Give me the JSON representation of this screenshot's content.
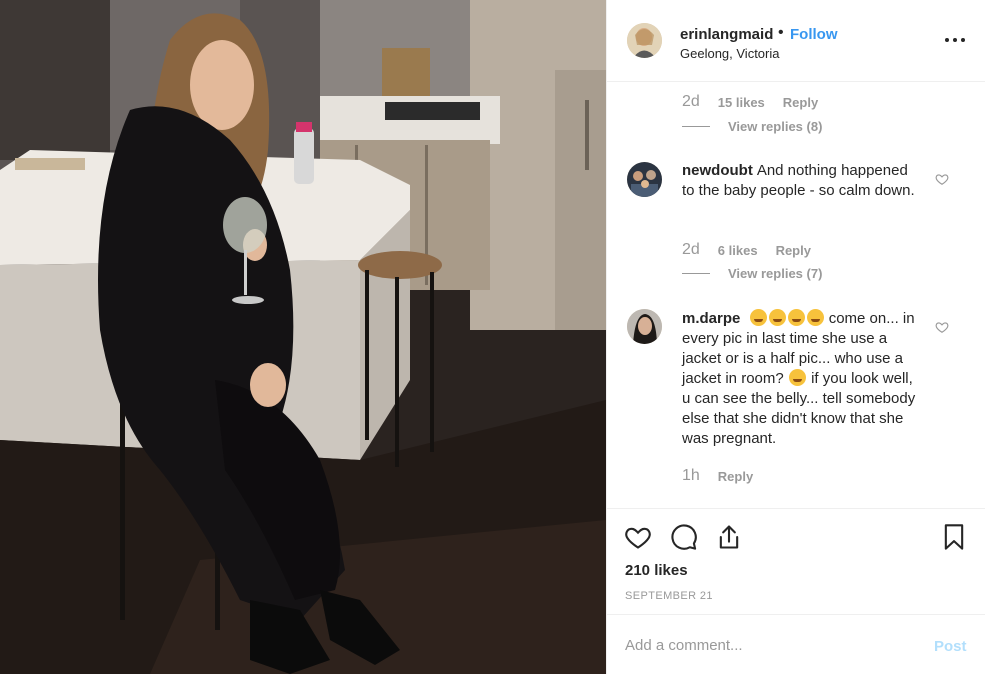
{
  "post": {
    "username": "erinlangmaid",
    "dot": "•",
    "follow_label": "Follow",
    "location": "Geelong, Victoria",
    "likes_total": "210 likes",
    "date": "SEPTEMBER 21"
  },
  "thread_top": {
    "time": "2d",
    "likes": "15 likes",
    "reply": "Reply",
    "view_replies": "View replies (8)"
  },
  "comments": [
    {
      "user": "newdoubt",
      "text": "And nothing happened to the baby people - so calm down.",
      "time": "2d",
      "likes": "6 likes",
      "reply": "Reply",
      "view_replies": "View replies (7)"
    },
    {
      "user": "m.darpe",
      "text_a": "come on... in every pic in last time she use a jacket or is a half pic... who use a jacket in room?",
      "text_b": "if you look well, u can see the belly... tell somebody else that she didn't know that she was pregnant.",
      "time": "1h",
      "reply": "Reply"
    }
  ],
  "add_comment": {
    "placeholder": "Add a comment...",
    "post_label": "Post"
  },
  "colors": {
    "follow": "#3897f0",
    "post_disabled": "#b2dffc",
    "muted": "#999999"
  },
  "icons": [
    "more-options-icon",
    "heart-icon",
    "comment-icon",
    "share-icon",
    "bookmark-icon"
  ]
}
